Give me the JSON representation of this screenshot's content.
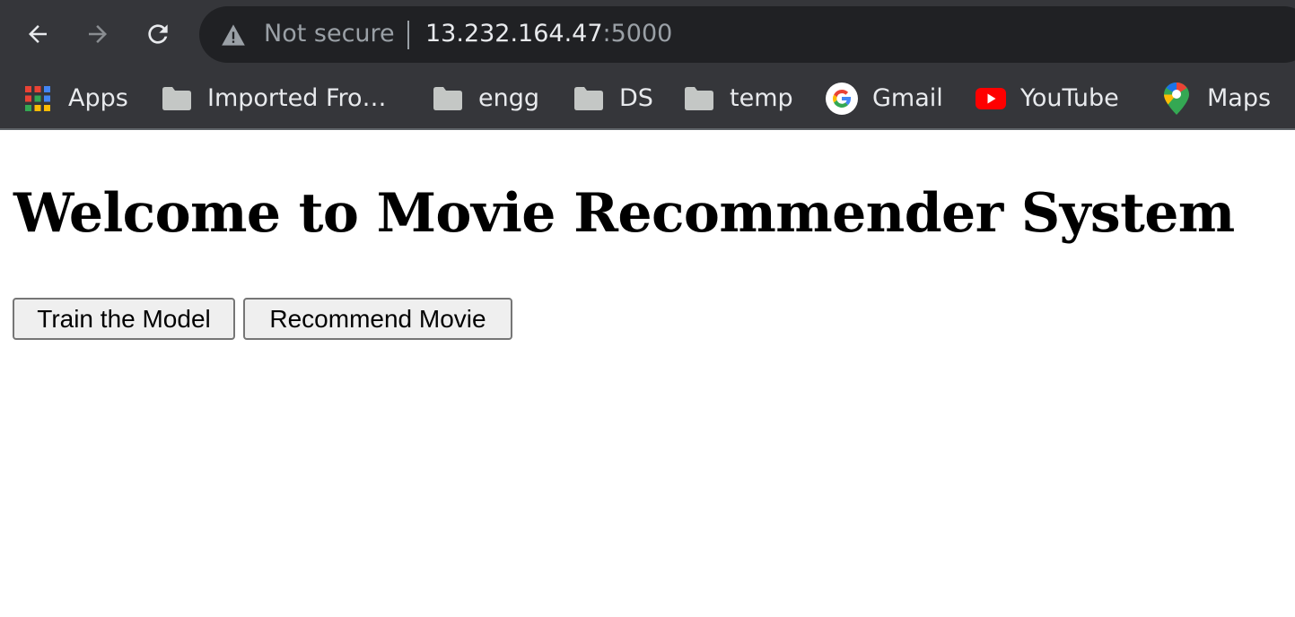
{
  "browser": {
    "security_label": "Not secure",
    "url_host": "13.232.164.47",
    "url_port": ":5000",
    "bookmarks": [
      {
        "label": "Apps",
        "icon": "apps-grid-icon"
      },
      {
        "label": "Imported Fro…",
        "icon": "folder-icon"
      },
      {
        "label": "engg",
        "icon": "folder-icon"
      },
      {
        "label": "DS",
        "icon": "folder-icon"
      },
      {
        "label": "temp",
        "icon": "folder-icon"
      },
      {
        "label": "Gmail",
        "icon": "google-icon"
      },
      {
        "label": "YouTube",
        "icon": "youtube-icon"
      },
      {
        "label": "Maps",
        "icon": "maps-pin-icon"
      }
    ]
  },
  "page": {
    "title": "Welcome to Movie Recommender System",
    "buttons": {
      "train_label": "Train the Model",
      "recommend_label": "Recommend Movie"
    }
  },
  "colors": {
    "chrome_bg": "#35363a",
    "omnibox_bg": "#202124",
    "chrome_text": "#e8eaed",
    "chrome_muted": "#9aa0a6",
    "button_bg": "#efefef",
    "button_border": "#767676"
  }
}
